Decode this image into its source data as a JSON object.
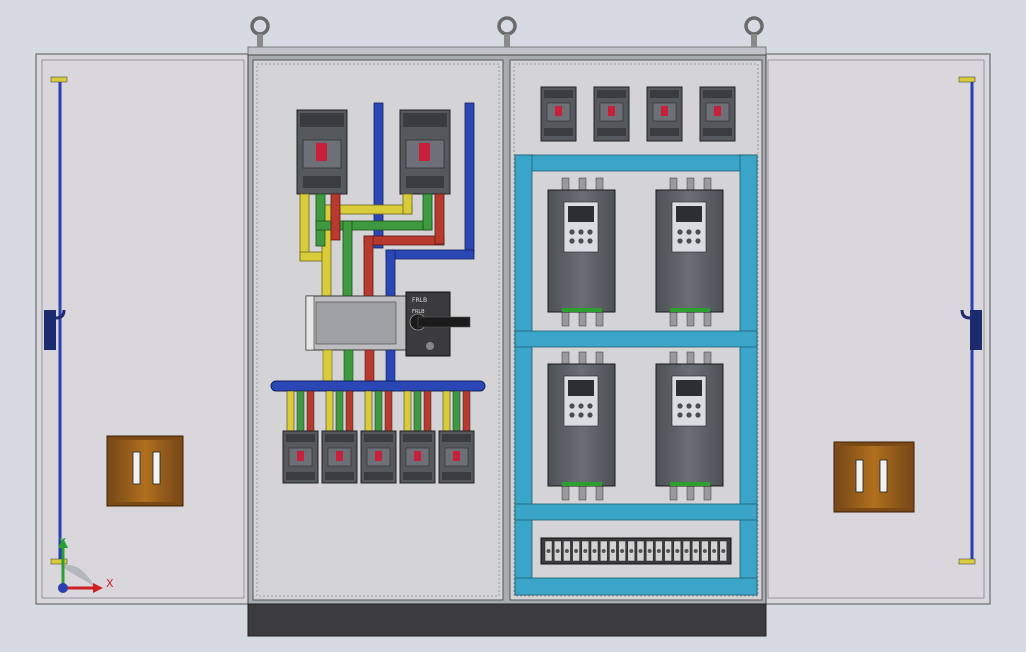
{
  "scene": {
    "background": "#d6dbe3",
    "door_color": "#d9d6dc",
    "cabinet_color": "#c9c9cc",
    "plinth_color": "#3c3c3e",
    "rail_color": "#3aa5c8",
    "busbar_colors": {
      "L1": "#d8cc3a",
      "L2": "#3f9a3f",
      "L3": "#b83a2e",
      "N": "#2a47b5"
    }
  },
  "left_door": {
    "handle": "door-lock-icon"
  },
  "right_door": {
    "handle": "door-lock-icon"
  },
  "left_section": {
    "main_breakers": 2,
    "feeder_breakers": 5,
    "isolator_label_1": "FRLB",
    "isolator_label_2": "FRLB"
  },
  "right_section": {
    "top_breakers": 4,
    "soft_starters": 4,
    "terminal_block_count": 20
  },
  "triad": {
    "x_label": "X",
    "y_label": "Y"
  }
}
